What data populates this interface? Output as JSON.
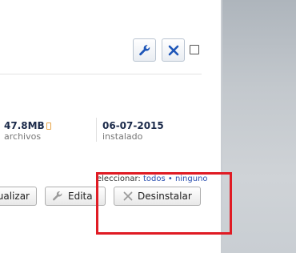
{
  "toolbar": {
    "wrench_icon": "wrench-icon",
    "close_icon": "close-icon",
    "accent_color": "#1e56b8"
  },
  "stats": [
    {
      "value": "47.8MB",
      "label": "archivos"
    },
    {
      "value": "06-07-2015",
      "label": "instalado"
    }
  ],
  "selection": {
    "prefix": "eleccionar:",
    "all_link": "todos",
    "separator": "•",
    "none_link": "ninguno"
  },
  "actions": {
    "update_label": "ualizar",
    "edit_label": "Edita",
    "uninstall_label": "Desinstalar"
  },
  "highlight_color": "#e01b24"
}
